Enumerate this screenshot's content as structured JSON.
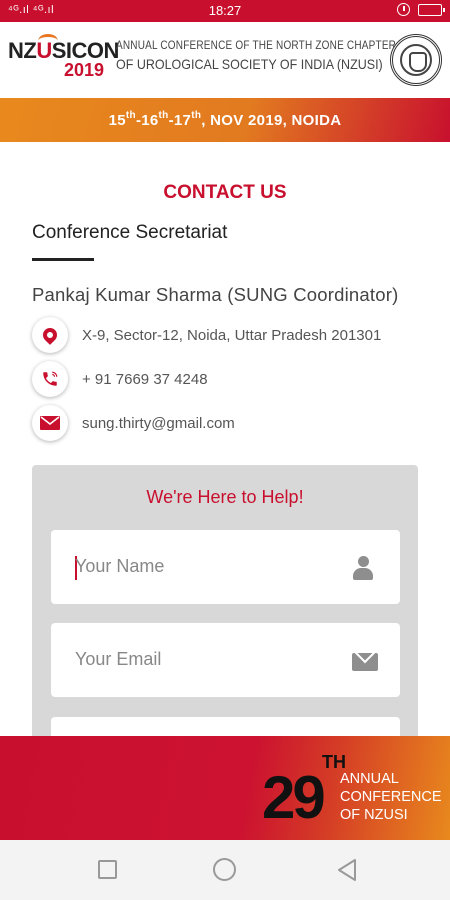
{
  "status_bar": {
    "signal": "⁴ᴳ.ıl ⁴ᴳ.ıl",
    "time": "18:27"
  },
  "header": {
    "logo_text_prefix": "NZ",
    "logo_text_u": "U",
    "logo_text_suffix": "SICON",
    "logo_year": "2019",
    "line1": "ANNUAL CONFERENCE OF THE NORTH ZONE CHAPTER",
    "line2": "OF UROLOGICAL SOCIETY OF INDIA (NZUSI)"
  },
  "date_banner": {
    "d1": "15",
    "d2": "16",
    "d3": "17",
    "sup": "th",
    "rest": ", NOV 2019, NOIDA"
  },
  "contact": {
    "title": "CONTACT US",
    "subtitle": "Conference Secretariat",
    "person": "Pankaj Kumar Sharma (SUNG Coordinator)",
    "address": "X-9, Sector-12, Noida, Uttar Pradesh 201301",
    "phone": "+ 91 7669 37 4248",
    "email": "sung.thirty@gmail.com"
  },
  "form": {
    "title": "We're Here to Help!",
    "name_placeholder": "Your Name",
    "email_placeholder": "Your Email",
    "third_placeholder": ""
  },
  "bottom_banner": {
    "number": "29",
    "suffix": "TH",
    "line1": "ANNUAL",
    "line2": "CONFERENCE",
    "line3": "OF NZUSI"
  },
  "colors": {
    "primary_red": "#c8102e",
    "accent_orange": "#e8891d"
  }
}
